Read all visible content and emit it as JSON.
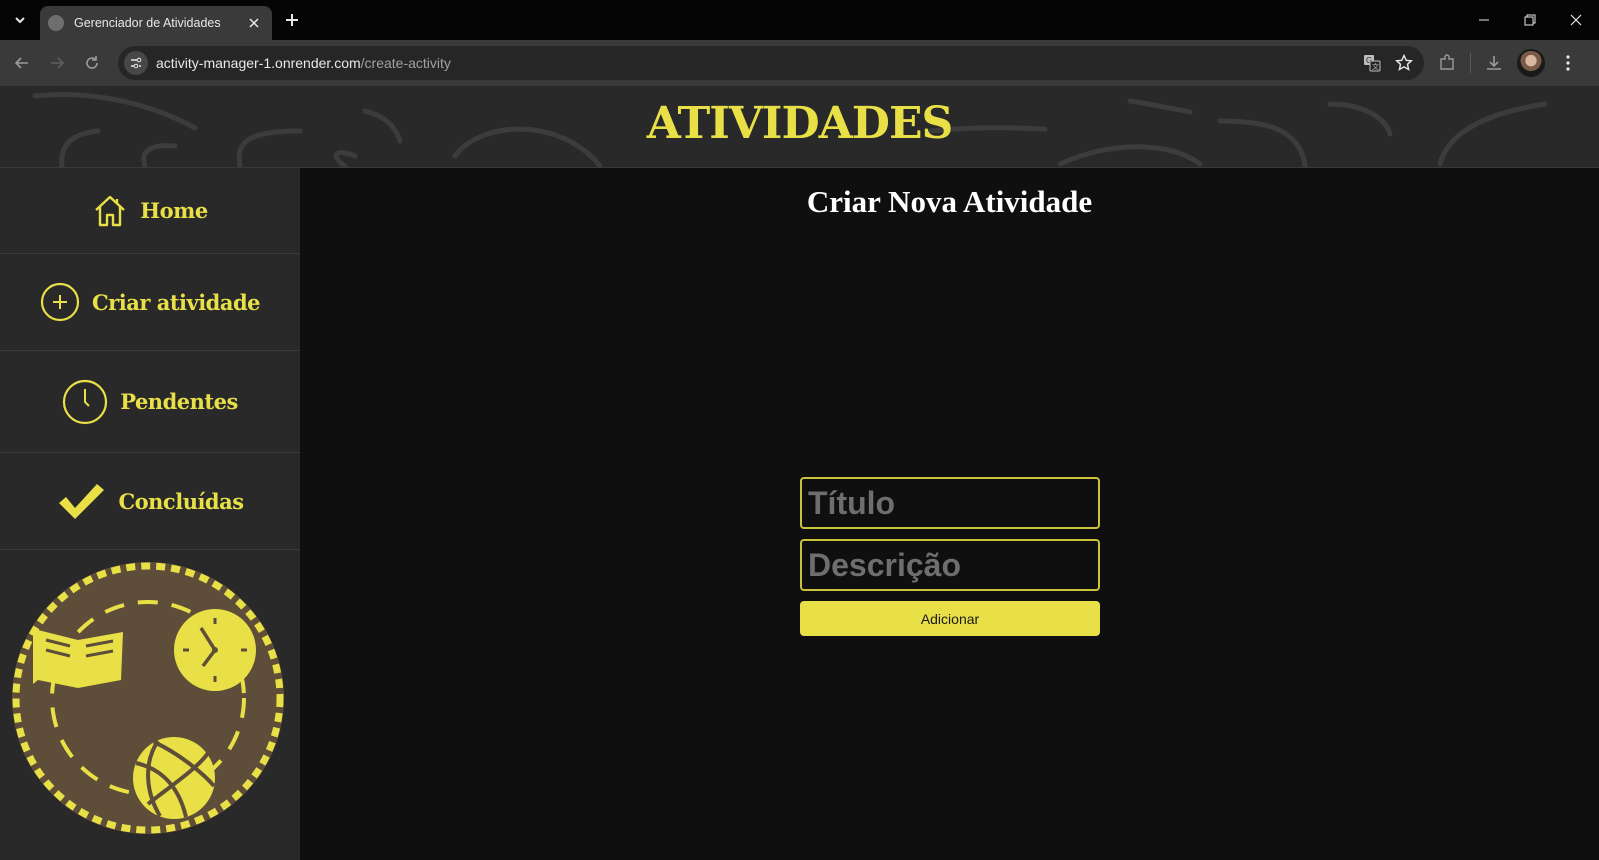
{
  "browser": {
    "tab_title": "Gerenciador de Atividades",
    "url_host": "activity-manager-1.onrender.com",
    "url_path": "/create-activity"
  },
  "header": {
    "title": "ATIVIDADES"
  },
  "sidebar": {
    "items": [
      {
        "label": "Home",
        "icon": "home-icon"
      },
      {
        "label": "Criar atividade",
        "icon": "plus-circle-icon"
      },
      {
        "label": "Pendentes",
        "icon": "clock-icon"
      },
      {
        "label": "Concluídas",
        "icon": "checkmark-icon"
      }
    ]
  },
  "main": {
    "title": "Criar Nova Atividade",
    "form": {
      "title_placeholder": "Título",
      "title_value": "",
      "description_placeholder": "Descrição",
      "description_value": "",
      "submit_label": "Adicionar"
    }
  },
  "colors": {
    "accent": "#e8e046",
    "sidebar_bg": "#292929",
    "main_bg": "#0f0f0f",
    "illustration_bg": "#5e4d38"
  }
}
